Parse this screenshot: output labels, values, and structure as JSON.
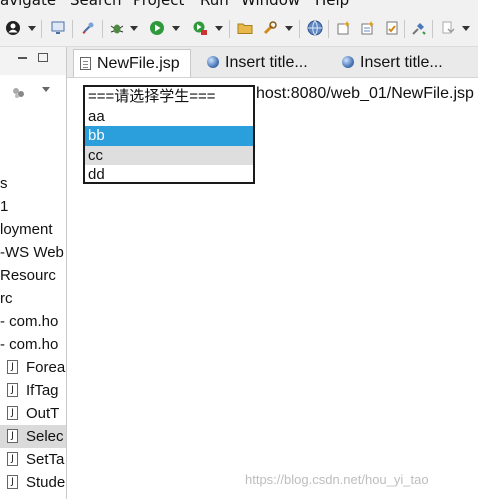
{
  "menu": [
    "avigate",
    "Search",
    "Project",
    "Run",
    "Window",
    "Help"
  ],
  "toolbar_icons": [
    "person-icon",
    "chevron-down-icon",
    "monitor-icon",
    "pin-icon",
    "bug-icon",
    "run-icon",
    "external-run-icon",
    "folder-icon",
    "wrench-icon",
    "globe-icon",
    "new-class-icon",
    "new-package-icon",
    "new-item-icon",
    "tasks-icon",
    "nav-back-icon"
  ],
  "left_panel": {
    "rows": [
      {
        "label": "s",
        "icon": null,
        "selected": false
      },
      {
        "label": "1",
        "icon": null,
        "selected": false
      },
      {
        "label": "loyment",
        "icon": null,
        "selected": false
      },
      {
        "label": "-WS Web",
        "icon": null,
        "selected": false
      },
      {
        "label": " Resourc",
        "icon": null,
        "selected": false
      },
      {
        "label": "rc",
        "icon": null,
        "selected": false
      },
      {
        "label": "- com.ho",
        "icon": null,
        "selected": false
      },
      {
        "label": "- com.ho",
        "icon": null,
        "selected": false
      },
      {
        "label": "Forea",
        "icon": "java-file-icon",
        "selected": false
      },
      {
        "label": "IfTag",
        "icon": "java-file-icon",
        "selected": false
      },
      {
        "label": "OutT",
        "icon": "java-file-icon",
        "selected": false
      },
      {
        "label": "Selec",
        "icon": "java-file-icon",
        "selected": true
      },
      {
        "label": "SetTa",
        "icon": "java-file-icon",
        "selected": false
      },
      {
        "label": "Stude",
        "icon": "java-file-icon",
        "selected": false
      }
    ]
  },
  "tabs": [
    {
      "label": "NewFile.jsp",
      "icon": "jsp-file-icon",
      "active": true
    },
    {
      "label": "Insert title...",
      "icon": "globe-icon",
      "active": false
    },
    {
      "label": "Insert title...",
      "icon": "globe-icon",
      "active": false
    }
  ],
  "url": "host:8080/web_01/NewFile.jsp",
  "select": {
    "options": [
      "===请选择学生===",
      "aa",
      "bb",
      "cc",
      "dd"
    ],
    "highlighted": "bb",
    "hover": "cc"
  },
  "watermark": "https://blog.csdn.net/hou_yi_tao",
  "colors": {
    "highlight": "#2a9fdc",
    "hover": "#dedede",
    "toolbar_bg": "#f1f1f1"
  }
}
